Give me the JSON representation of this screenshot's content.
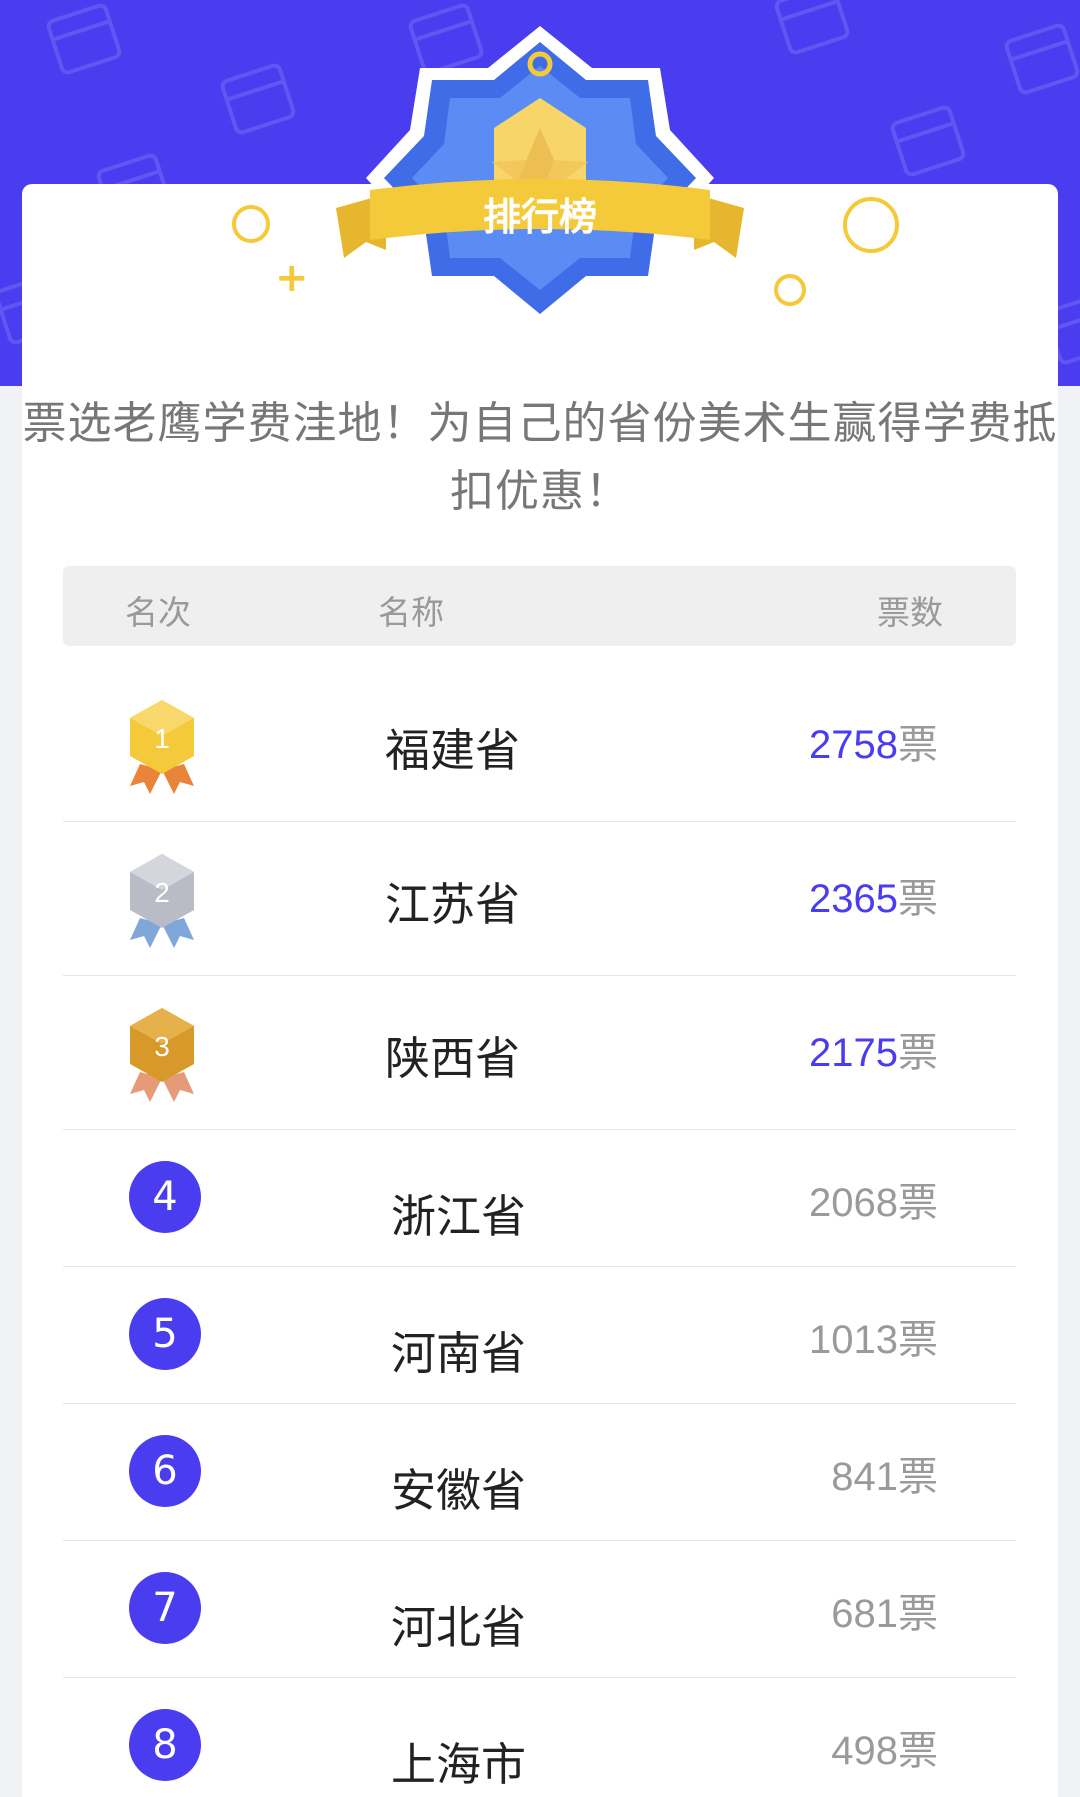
{
  "badge": {
    "title": "排行榜"
  },
  "intro": {
    "text": "票选老鹰学费洼地！为自己的省份美术生赢得学费抵扣优惠！"
  },
  "table": {
    "headers": {
      "rank": "名次",
      "name": "名称",
      "votes": "票数"
    },
    "vote_unit": "票",
    "rows": [
      {
        "rank": "1",
        "name": "福建省",
        "votes": "2758",
        "medal": "gold"
      },
      {
        "rank": "2",
        "name": "江苏省",
        "votes": "2365",
        "medal": "silver"
      },
      {
        "rank": "3",
        "name": "陕西省",
        "votes": "2175",
        "medal": "bronze"
      },
      {
        "rank": "4",
        "name": "浙江省",
        "votes": "2068"
      },
      {
        "rank": "5",
        "name": "河南省",
        "votes": "1013"
      },
      {
        "rank": "6",
        "name": "安徽省",
        "votes": "841"
      },
      {
        "rank": "7",
        "name": "河北省",
        "votes": "681"
      },
      {
        "rank": "8",
        "name": "上海市",
        "votes": "498"
      }
    ]
  },
  "colors": {
    "brand": "#4a3df0",
    "gold": "#f4c93a",
    "silver": "#b9bcc4",
    "bronze": "#d79a2a"
  },
  "icons": {
    "header_decoration": "gift-box-icon",
    "medal_gold": "gold-medal-icon",
    "medal_silver": "silver-medal-icon",
    "medal_bronze": "bronze-medal-icon"
  }
}
